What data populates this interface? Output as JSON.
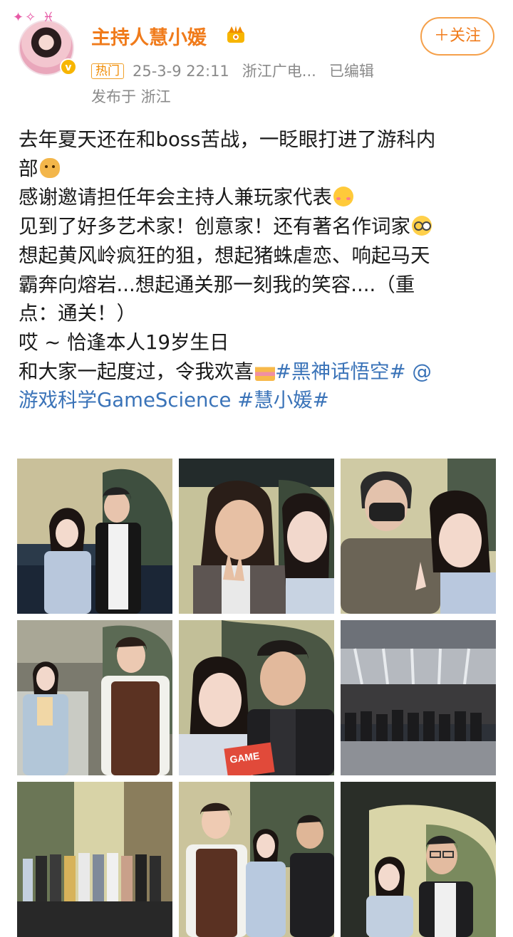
{
  "header": {
    "username": "主持人慧小媛",
    "hot_tag": "热门",
    "timestamp": "25-3-9 22:11",
    "source": "浙江广电...",
    "edited": "已编辑",
    "location": "发布于 浙江",
    "follow_label": "＋关注",
    "verified_icon": "v-badge-icon",
    "avatar_deco": "✦✧ ♓"
  },
  "post": {
    "lines": [
      "去年夏天还在和boss苦战，一眨眼打进了游科内",
      "部",
      "感谢邀请担任年会主持人兼玩家代表",
      "见到了好多艺术家！创意家！还有著名作词家",
      "想起黄风岭疯狂的狙，想起猪蛛虐恋、响起马天",
      "霸奔向熔岩...想起通关那一刻我的笑容....（重",
      "点：通关！）",
      "哎 ~ 恰逢本人19岁生日",
      "和大家一起度过，令我欢喜"
    ],
    "topic_1": "#黑神话悟空#",
    "mention": "@",
    "mention_2": "游戏科学GameScience",
    "topic_2": "#慧小媛#"
  },
  "photos": [
    {
      "name": "photo-host-with-man-stage"
    },
    {
      "name": "photo-host-with-longhair-man-selfie"
    },
    {
      "name": "photo-host-with-masked-man-selfie"
    },
    {
      "name": "photo-host-with-young-man-vest"
    },
    {
      "name": "photo-host-with-man-game-science-sign"
    },
    {
      "name": "photo-audience-hall-group"
    },
    {
      "name": "photo-stage-group-lineup"
    },
    {
      "name": "photo-host-with-two-men"
    },
    {
      "name": "photo-host-with-glasses-man"
    }
  ],
  "colors": {
    "accent": "#f07b1b",
    "link": "#3a73b8",
    "meta": "#8a8a8a"
  }
}
